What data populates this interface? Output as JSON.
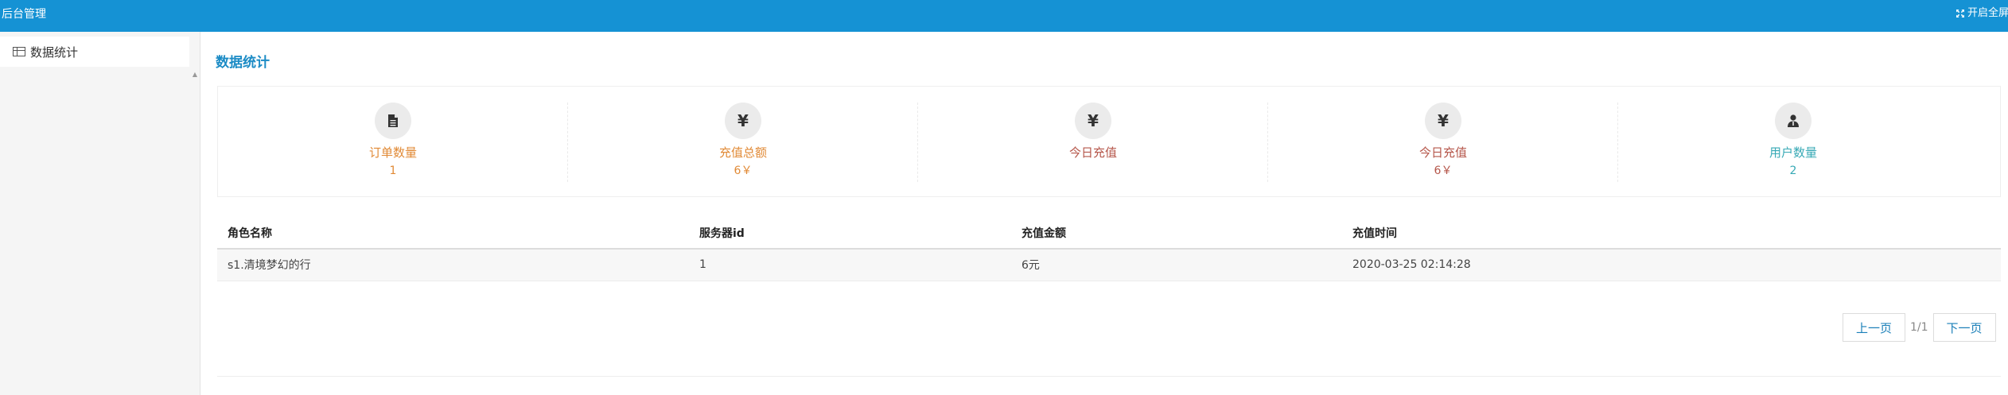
{
  "header": {
    "brand": "后台管理",
    "fullscreen_label": "开启全屏"
  },
  "sidebar": {
    "items": [
      {
        "label": "数据统计"
      }
    ]
  },
  "main": {
    "title": "数据统计",
    "stats": [
      {
        "icon": "document-icon",
        "label": "订单数量",
        "value": "1",
        "color": "#e18a36"
      },
      {
        "icon": "yen-icon",
        "label": "充值总额",
        "value": "6￥",
        "color": "#e18a36"
      },
      {
        "icon": "yen-icon",
        "label": "今日充值",
        "value": "",
        "color": "#b5564a"
      },
      {
        "icon": "yen-icon",
        "label": "今日充值",
        "value": "6￥",
        "color": "#b5564a"
      },
      {
        "icon": "user-icon",
        "label": "用户数量",
        "value": "2",
        "color": "#37a9b5"
      }
    ],
    "table": {
      "columns": [
        "角色名称",
        "服务器id",
        "充值金额",
        "充值时间"
      ],
      "rows": [
        [
          "s1.清境梦幻的行",
          "1",
          "6元",
          "2020-03-25 02:14:28"
        ]
      ]
    },
    "pager": {
      "prev": "上一页",
      "info": "1/1",
      "next": "下一页"
    }
  }
}
